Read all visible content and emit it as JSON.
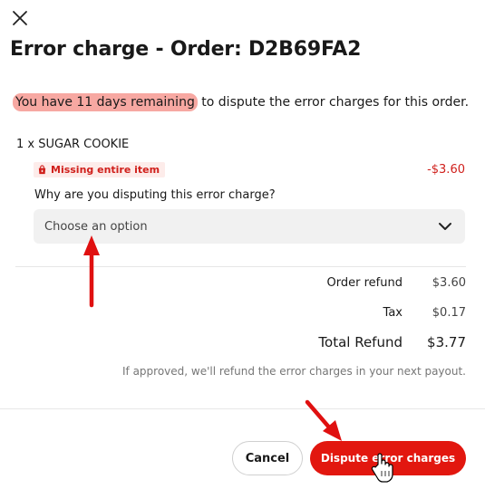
{
  "dialog": {
    "title": "Error charge - Order: D2B69FA2",
    "notice_highlight": "You have 11 days remaining",
    "notice_rest": " to dispute the error charges for this order."
  },
  "item": {
    "name": "1 x SUGAR COOKIE",
    "badge_label": "Missing entire item",
    "amount": "-$3.60"
  },
  "dispute": {
    "question": "Why are you disputing this error charge?",
    "select_placeholder": "Choose an option"
  },
  "summary": {
    "order_refund_label": "Order refund",
    "order_refund_value": "$3.60",
    "tax_label": "Tax",
    "tax_value": "$0.17",
    "total_label": "Total Refund",
    "total_value": "$3.77",
    "note": "If approved, we'll refund the error charges in your next payout."
  },
  "footer": {
    "cancel_label": "Cancel",
    "dispute_label": "Dispute error charges"
  },
  "colors": {
    "accent": "#e2170f",
    "badge_text": "#d0201c",
    "highlight": "#f7a8a2",
    "annotation_arrow": "#e01010"
  },
  "icons": [
    "close-icon",
    "bag-icon",
    "chevron-down-icon",
    "hand-cursor-icon"
  ]
}
